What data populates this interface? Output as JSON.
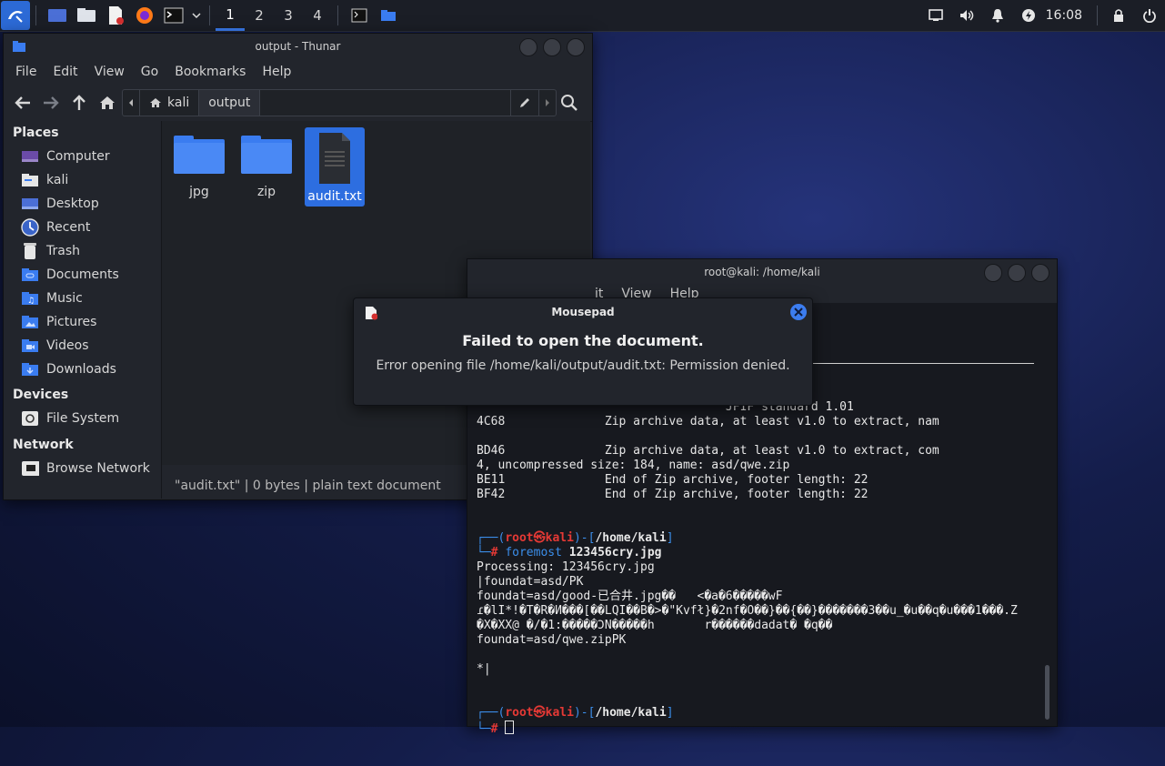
{
  "panel": {
    "workspaces": [
      "1",
      "2",
      "3",
      "4"
    ],
    "active_workspace": "1",
    "clock": "16:08",
    "tray_icons": [
      "display-icon",
      "volume-icon",
      "bell-icon",
      "power-icon",
      "lock-icon",
      "logout-icon"
    ]
  },
  "thunar": {
    "title": "output - Thunar",
    "menu": [
      "File",
      "Edit",
      "View",
      "Go",
      "Bookmarks",
      "Help"
    ],
    "path": [
      "kali",
      "output"
    ],
    "places_header": "Places",
    "places": [
      "Computer",
      "kali",
      "Desktop",
      "Recent",
      "Trash",
      "Documents",
      "Music",
      "Pictures",
      "Videos",
      "Downloads"
    ],
    "devices_header": "Devices",
    "devices": [
      "File System"
    ],
    "network_header": "Network",
    "network": [
      "Browse Network"
    ],
    "files": [
      "jpg",
      "zip",
      "audit.txt"
    ],
    "selected_file": "audit.txt",
    "status": "\"audit.txt\"  |  0 bytes  |  plain text document"
  },
  "terminal": {
    "title": "root@kali: /home/kali",
    "menu": [
      "it",
      "View",
      "Help"
    ],
    "output_lines": [
      "                                   JFIF standard 1.01",
      "4C68              Zip archive data, at least v1.0 to extract, nam",
      "",
      "BD46              Zip archive data, at least v1.0 to extract, com",
      "4, uncompressed size: 184, name: asd/qwe.zip",
      "BE11              End of Zip archive, footer length: 22",
      "BF42              End of Zip archive, footer length: 22"
    ],
    "prompt_user": "root",
    "prompt_host": "kali",
    "prompt_dir": "/home/kali",
    "command_name": "foremost",
    "command_arg": "123456cry.jpg",
    "lines_after": [
      "Processing: 123456cry.jpg",
      "|foundat=asd/PK",
      "foundat=asd/good-已合井.jpg��   <�a�6�����wF",
      "ɾ�lI*!�T�R�И���[��LQI��B�>�\"Kvfł}�2nf�O��}��{��}�������3��u_�u��q�u���1���.Z",
      "�X�XX@ �/�1:�����ϽN�����h       r������dadat� �q��",
      "foundat=asd/qwe.zipPK",
      "",
      "*|"
    ]
  },
  "dialog": {
    "title": "Mousepad",
    "heading": "Failed to open the document.",
    "message": "Error opening file /home/kali/output/audit.txt: Permission denied."
  }
}
